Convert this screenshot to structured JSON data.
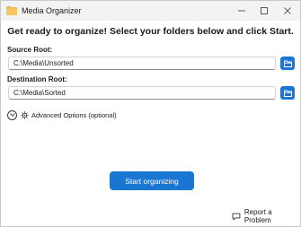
{
  "window": {
    "title": "Media Organizer",
    "icon": "folder-app-icon"
  },
  "heading": "Get ready to organize! Select your folders below and click Start.",
  "source": {
    "label": "Source Root:",
    "value": "C:\\Media\\Unsorted",
    "browse_icon": "folder-open-icon"
  },
  "destination": {
    "label": "Destination Root:",
    "value": "C:\\Media\\Sorted",
    "browse_icon": "folder-open-icon"
  },
  "advanced": {
    "label": "Advanced Options (optional)",
    "expanded": false
  },
  "actions": {
    "start_label": "Start organizing",
    "report_label": "Report a Problem"
  },
  "colors": {
    "accent": "#1976d2",
    "titlebar": "#f3f3f3",
    "background": "#ffffff"
  }
}
